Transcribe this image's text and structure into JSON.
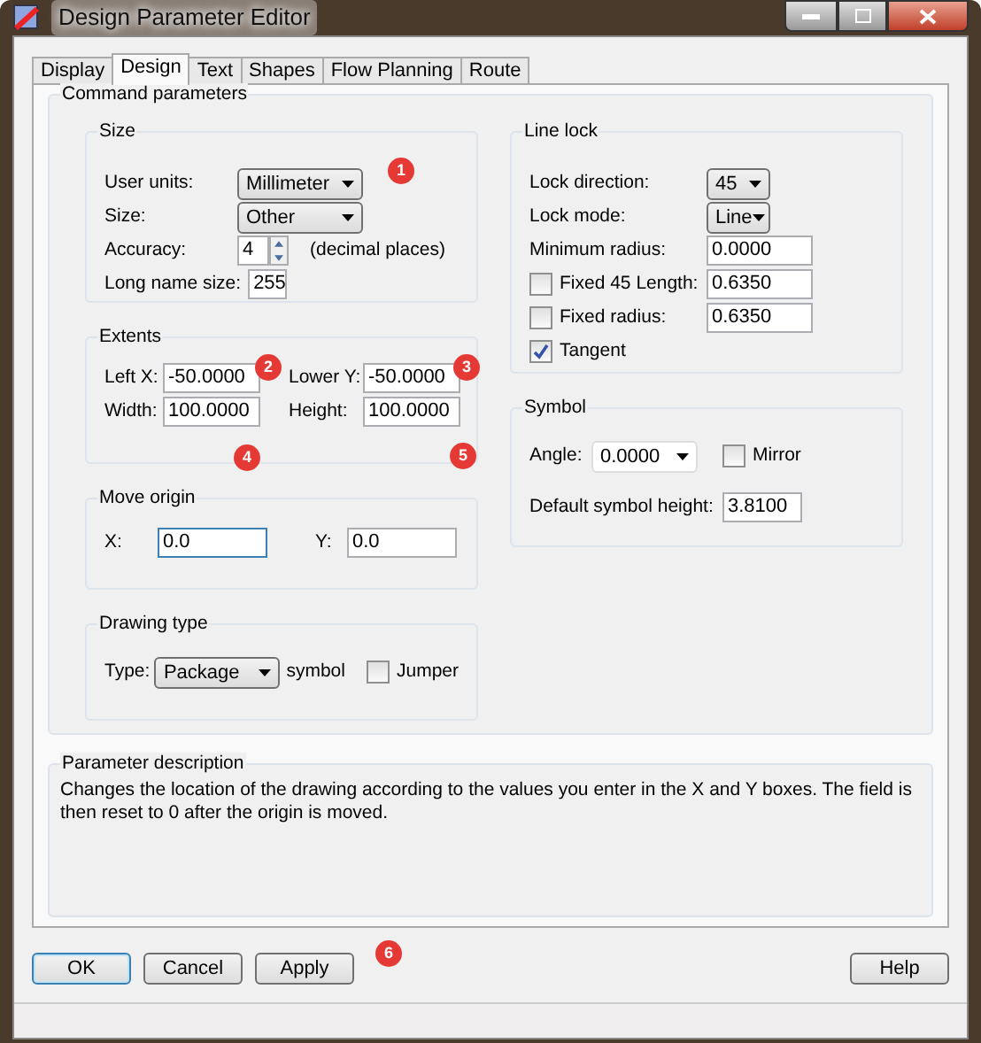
{
  "window": {
    "title": "Design Parameter Editor"
  },
  "tabs": [
    {
      "label": "Display",
      "selected": false
    },
    {
      "label": "Design",
      "selected": true
    },
    {
      "label": "Text",
      "selected": false
    },
    {
      "label": "Shapes",
      "selected": false
    },
    {
      "label": "Flow Planning",
      "selected": false
    },
    {
      "label": "Route",
      "selected": false
    }
  ],
  "command_parameters": {
    "title": "Command parameters",
    "size": {
      "title": "Size",
      "user_units": {
        "label": "User units:",
        "value": "Millimeter"
      },
      "size": {
        "label": "Size:",
        "value": "Other"
      },
      "accuracy": {
        "label": "Accuracy:",
        "value": "4",
        "suffix": "(decimal places)"
      },
      "long_name_size": {
        "label": "Long name size:",
        "value": "255"
      }
    },
    "extents": {
      "title": "Extents",
      "left_x": {
        "label": "Left X:",
        "value": "-50.0000"
      },
      "lower_y": {
        "label": "Lower Y:",
        "value": "-50.0000"
      },
      "width": {
        "label": "Width:",
        "value": "100.0000"
      },
      "height": {
        "label": "Height:",
        "value": "100.0000"
      }
    },
    "move_origin": {
      "title": "Move origin",
      "x": {
        "label": "X:",
        "value": "0.0",
        "focused": true
      },
      "y": {
        "label": "Y:",
        "value": "0.0",
        "focused": false
      }
    },
    "drawing_type": {
      "title": "Drawing type",
      "type": {
        "label": "Type:",
        "value": "Package"
      },
      "suffix": "symbol",
      "jumper": {
        "label": "Jumper",
        "checked": false
      }
    },
    "line_lock": {
      "title": "Line lock",
      "lock_direction": {
        "label": "Lock direction:",
        "value": "45"
      },
      "lock_mode": {
        "label": "Lock mode:",
        "value": "Line"
      },
      "minimum_radius": {
        "label": "Minimum radius:",
        "value": "0.0000"
      },
      "fixed_45_length": {
        "label": "Fixed 45 Length:",
        "checked": false,
        "value": "0.6350"
      },
      "fixed_radius": {
        "label": "Fixed radius:",
        "checked": false,
        "value": "0.6350"
      },
      "tangent": {
        "label": "Tangent",
        "checked": true
      }
    },
    "symbol": {
      "title": "Symbol",
      "angle": {
        "label": "Angle:",
        "value": "0.0000"
      },
      "mirror": {
        "label": "Mirror",
        "checked": false
      },
      "default_symbol_height": {
        "label": "Default symbol height:",
        "value": "3.8100"
      }
    }
  },
  "parameter_description": {
    "title": "Parameter description",
    "text": "Changes the location of the drawing according to the values you enter in the X and Y boxes. The field is then reset to 0 after the origin is moved."
  },
  "buttons": [
    {
      "label": "OK",
      "default": true
    },
    {
      "label": "Cancel",
      "default": false
    },
    {
      "label": "Apply",
      "default": false
    },
    {
      "label": "Help",
      "default": false
    }
  ],
  "annotations": [
    "1",
    "2",
    "3",
    "4",
    "5",
    "6"
  ]
}
